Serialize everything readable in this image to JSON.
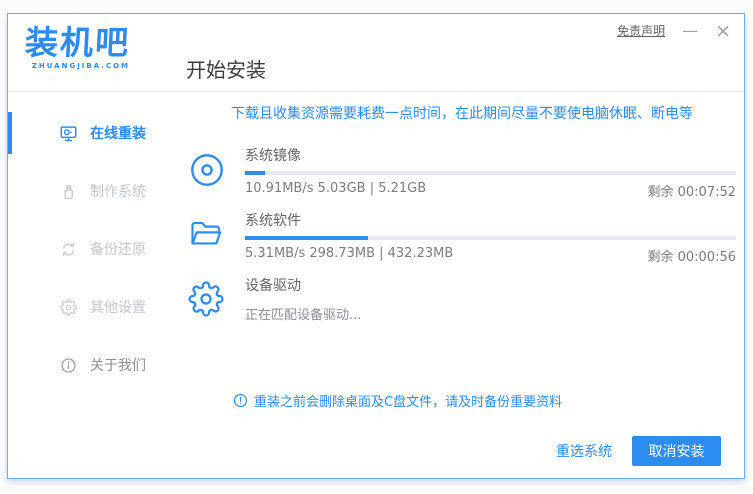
{
  "logo": {
    "text": "装机吧",
    "subtext": "ZHUANGJIBA.COM"
  },
  "header": {
    "title": "开始安装",
    "disclaimer": "免责声明",
    "minimize": "—",
    "close": "×"
  },
  "sidebar": {
    "items": [
      {
        "label": "在线重装",
        "icon": "monitor-reinstall-icon",
        "active": true
      },
      {
        "label": "制作系统",
        "icon": "usb-drive-icon",
        "active": false
      },
      {
        "label": "备份还原",
        "icon": "backup-restore-icon",
        "active": false
      },
      {
        "label": "其他设置",
        "icon": "gear-icon",
        "active": false
      },
      {
        "label": "关于我们",
        "icon": "info-icon",
        "active": false
      }
    ]
  },
  "main": {
    "warning": "下载且收集资源需要耗费一点时间，在此期间尽量不要使电脑休眠、断电等",
    "tasks": [
      {
        "name": "系统镜像",
        "icon": "disc-icon",
        "stats": "10.91MB/s 5.03GB | 5.21GB",
        "remaining": "剩余 00:07:52",
        "progress_percent": 4
      },
      {
        "name": "系统软件",
        "icon": "open-folder-icon",
        "stats": "5.31MB/s 298.73MB | 432.23MB",
        "remaining": "剩余 00:00:56",
        "progress_percent": 25
      },
      {
        "name": "设备驱动",
        "icon": "gear-icon",
        "status": "正在匹配设备驱动..."
      }
    ],
    "notice": "重装之前会删除桌面及C盘文件，请及时备份重要资料"
  },
  "footer": {
    "reselect": "重选系统",
    "cancel": "取消安装"
  },
  "colors": {
    "accent": "#2d8cf0",
    "inactive_text": "#c3c7cc",
    "progress_track": "#e6e9ef",
    "window_border": "#6faaee"
  }
}
